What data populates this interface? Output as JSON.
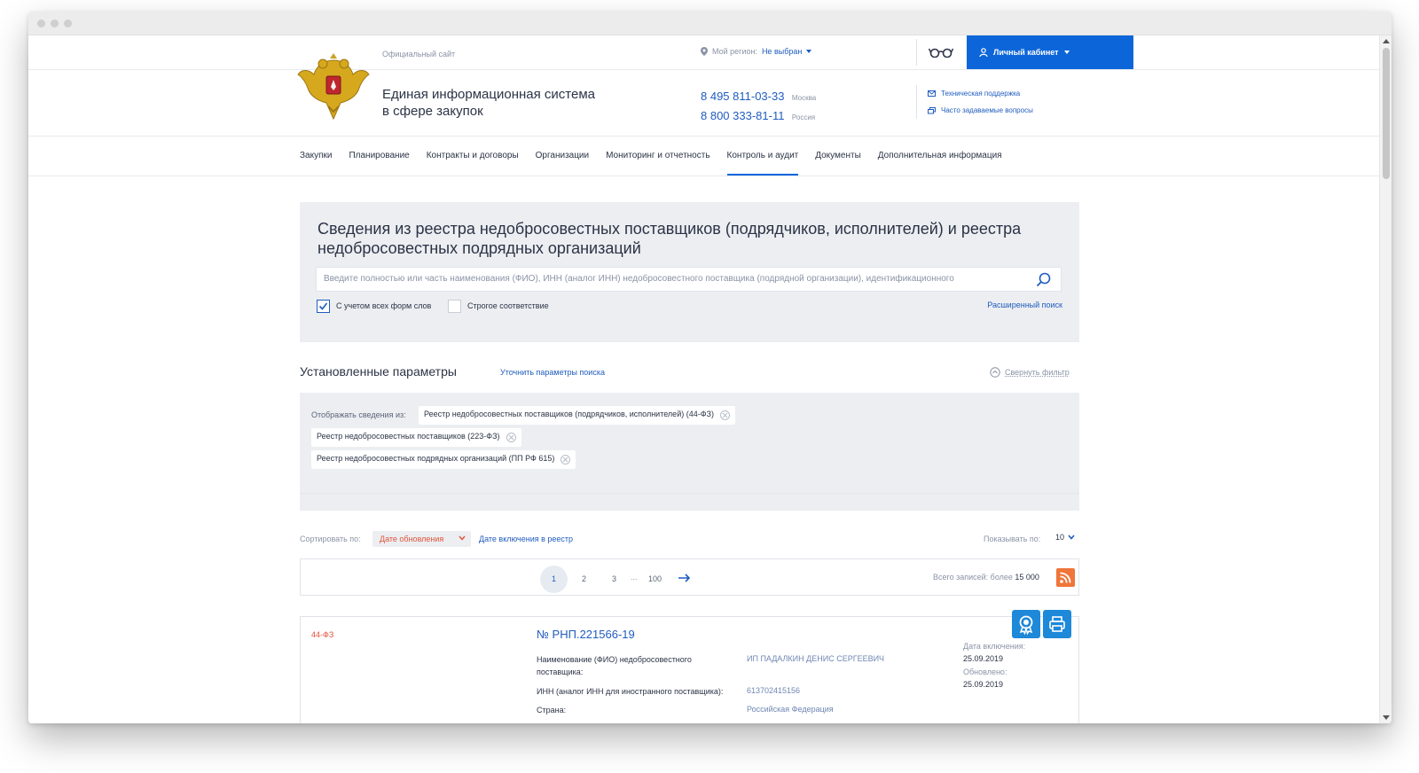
{
  "header": {
    "official_site": "Официальный сайт",
    "region_label": "Мой регион:",
    "region_value": "Не выбран",
    "cabinet_label": "Личный кабинет",
    "title_line1": "Единая информационная система",
    "title_line2": "в сфере закупок",
    "phone1": "8 495 811-03-33",
    "phone1_city": "Москва",
    "phone2": "8 800 333-81-11",
    "phone2_city": "Россия",
    "support_link": "Техническая поддержка",
    "faq_link": "Часто задаваемые вопросы"
  },
  "nav": {
    "items": [
      {
        "label": "Закупки"
      },
      {
        "label": "Планирование"
      },
      {
        "label": "Контракты и договоры"
      },
      {
        "label": "Организации"
      },
      {
        "label": "Мониторинг и отчетность"
      },
      {
        "label": "Контроль и аудит"
      },
      {
        "label": "Документы"
      },
      {
        "label": "Дополнительная информация"
      }
    ],
    "active": "Контроль и аудит"
  },
  "search": {
    "title": "Сведения из реестра недобросовестных поставщиков (подрядчиков, исполнителей) и реестра недобросовестных подрядных организаций",
    "placeholder": "Введите полностью или часть наименования (ФИО), ИНН (аналог ИНН) недобросовестного поставщика (подрядной организации), идентификационного",
    "checkbox_all_forms": "С учетом всех форм слов",
    "checkbox_all_forms_checked": true,
    "checkbox_strict": "Строгое соответствие",
    "checkbox_strict_checked": false,
    "advanced_link": "Расширенный поиск"
  },
  "params": {
    "heading": "Установленные параметры",
    "refine_link": "Уточнить параметры поиска",
    "collapse_link": "Свернуть фильтр",
    "show_from_label": "Отображать сведения из:",
    "tags": [
      {
        "label": "Реестр недобросовестных поставщиков (подрядчиков, исполнителей) (44-ФЗ)"
      },
      {
        "label": "Реестр недобросовестных поставщиков (223-ФЗ)"
      },
      {
        "label": "Реестр недобросовестных подрядных организаций (ПП РФ 615)"
      }
    ]
  },
  "sorting": {
    "label": "Сортировать по:",
    "selected": "Дате обновления",
    "alt_link": "Дате включения в реестр",
    "per_page_label": "Показывать по:",
    "per_page_value": "10"
  },
  "pager": {
    "pages": [
      "1",
      "2",
      "3"
    ],
    "ellipsis": "...",
    "last": "100",
    "current": "1",
    "total_label": "Всего записей: более",
    "total_value": "15 000"
  },
  "record": {
    "law": "44-ФЗ",
    "number": "№ РНП.221566-19",
    "name_label": "Наименование (ФИО) недобросовестного поставщика:",
    "name_value": "ИП ПАДАЛКИН ДЕНИС СЕРГЕЕВИЧ",
    "inn_label": "ИНН (аналог ИНН для иностранного поставщика):",
    "inn_value": "613702415156",
    "country_label": "Страна:",
    "country_value": "Российская Федерация",
    "included_label": "Дата включения:",
    "included_value": "25.09.2019",
    "updated_label": "Обновлено:",
    "updated_value": "25.09.2019"
  },
  "colors": {
    "primary": "#0c66d9",
    "link": "#1f5cbf",
    "accent_red": "#e0543b",
    "panel_bg": "#eceef1",
    "rss": "#f0753a",
    "action_btn": "#1e88d9"
  }
}
